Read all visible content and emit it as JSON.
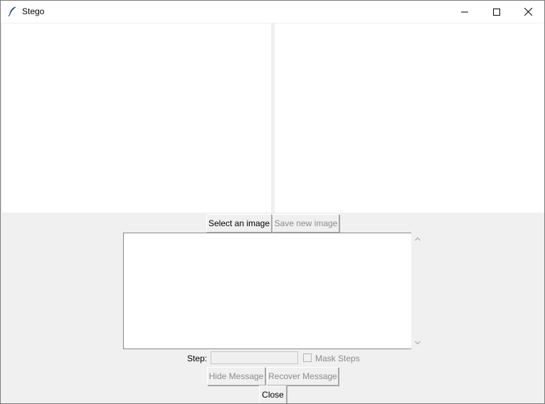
{
  "window": {
    "title": "Stego",
    "app_icon": "feather-icon",
    "controls": {
      "minimize": "minimize-icon",
      "maximize": "maximize-icon",
      "close": "close-icon"
    }
  },
  "toolbar": {
    "select_label": "Select an image",
    "save_label": "Save new image"
  },
  "message": {
    "value": ""
  },
  "step": {
    "label": "Step:",
    "value": ""
  },
  "mask": {
    "label": "Mask Steps",
    "checked": false
  },
  "actions": {
    "hide_label": "Hide Message",
    "recover_label": "Recover Message",
    "close_label": "Close"
  },
  "colors": {
    "background": "#f0f0f0",
    "pane": "#ffffff",
    "disabled_text": "#8b8b8b"
  }
}
